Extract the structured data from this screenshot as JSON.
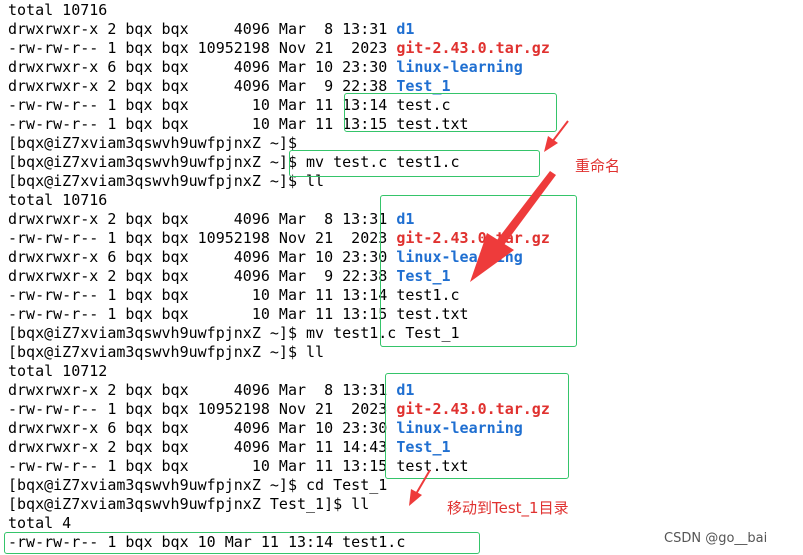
{
  "terminal": {
    "lines": [
      {
        "parts": [
          {
            "t": "total 10716"
          }
        ]
      },
      {
        "parts": [
          {
            "t": "drwxrwxr-x 2 bqx bqx     4096 Mar  8 13:31 "
          },
          {
            "t": "d1",
            "c": "blue"
          }
        ]
      },
      {
        "parts": [
          {
            "t": "-rw-rw-r-- 1 bqx bqx 10952198 Nov 21  2023 "
          },
          {
            "t": "git-2.43.0.tar.gz",
            "c": "red"
          }
        ]
      },
      {
        "parts": [
          {
            "t": "drwxrwxr-x 6 bqx bqx     4096 Mar 10 23:30 "
          },
          {
            "t": "linux-learning",
            "c": "blue"
          }
        ]
      },
      {
        "parts": [
          {
            "t": "drwxrwxr-x 2 bqx bqx     4096 Mar  9 22:38 "
          },
          {
            "t": "Test_1",
            "c": "blue"
          }
        ]
      },
      {
        "parts": [
          {
            "t": "-rw-rw-r-- 1 bqx bqx       10 Mar 11 13:14 test.c"
          }
        ]
      },
      {
        "parts": [
          {
            "t": "-rw-rw-r-- 1 bqx bqx       10 Mar 11 13:15 test.txt"
          }
        ]
      },
      {
        "parts": [
          {
            "t": "[bqx@iZ7xviam3qswvh9uwfpjnxZ ~]$"
          }
        ]
      },
      {
        "parts": [
          {
            "t": "[bqx@iZ7xviam3qswvh9uwfpjnxZ ~]$ mv test.c test1.c"
          }
        ]
      },
      {
        "parts": [
          {
            "t": "[bqx@iZ7xviam3qswvh9uwfpjnxZ ~]$ ll"
          }
        ]
      },
      {
        "parts": [
          {
            "t": "total 10716"
          }
        ]
      },
      {
        "parts": [
          {
            "t": "drwxrwxr-x 2 bqx bqx     4096 Mar  8 13:31 "
          },
          {
            "t": "d1",
            "c": "blue"
          }
        ]
      },
      {
        "parts": [
          {
            "t": "-rw-rw-r-- 1 bqx bqx 10952198 Nov 21  2023 "
          },
          {
            "t": "git-2.43.0.tar.gz",
            "c": "red"
          }
        ]
      },
      {
        "parts": [
          {
            "t": "drwxrwxr-x 6 bqx bqx     4096 Mar 10 23:30 "
          },
          {
            "t": "linux-learning",
            "c": "blue"
          }
        ]
      },
      {
        "parts": [
          {
            "t": "drwxrwxr-x 2 bqx bqx     4096 Mar  9 22:38 "
          },
          {
            "t": "Test_1",
            "c": "blue"
          }
        ]
      },
      {
        "parts": [
          {
            "t": "-rw-rw-r-- 1 bqx bqx       10 Mar 11 13:14 test1.c"
          }
        ]
      },
      {
        "parts": [
          {
            "t": "-rw-rw-r-- 1 bqx bqx       10 Mar 11 13:15 test.txt"
          }
        ]
      },
      {
        "parts": [
          {
            "t": "[bqx@iZ7xviam3qswvh9uwfpjnxZ ~]$ mv test1.c Test_1"
          }
        ]
      },
      {
        "parts": [
          {
            "t": "[bqx@iZ7xviam3qswvh9uwfpjnxZ ~]$ ll"
          }
        ]
      },
      {
        "parts": [
          {
            "t": "total 10712"
          }
        ]
      },
      {
        "parts": [
          {
            "t": "drwxrwxr-x 2 bqx bqx     4096 Mar  8 13:31 "
          },
          {
            "t": "d1",
            "c": "blue"
          }
        ]
      },
      {
        "parts": [
          {
            "t": "-rw-rw-r-- 1 bqx bqx 10952198 Nov 21  2023 "
          },
          {
            "t": "git-2.43.0.tar.gz",
            "c": "red"
          }
        ]
      },
      {
        "parts": [
          {
            "t": "drwxrwxr-x 6 bqx bqx     4096 Mar 10 23:30 "
          },
          {
            "t": "linux-learning",
            "c": "blue"
          }
        ]
      },
      {
        "parts": [
          {
            "t": "drwxrwxr-x 2 bqx bqx     4096 Mar 11 14:43 "
          },
          {
            "t": "Test_1",
            "c": "blue"
          }
        ]
      },
      {
        "parts": [
          {
            "t": "-rw-rw-r-- 1 bqx bqx       10 Mar 11 13:15 test.txt"
          }
        ]
      },
      {
        "parts": [
          {
            "t": "[bqx@iZ7xviam3qswvh9uwfpjnxZ ~]$ cd Test_1"
          }
        ]
      },
      {
        "parts": [
          {
            "t": "[bqx@iZ7xviam3qswvh9uwfpjnxZ Test_1]$ ll"
          }
        ]
      },
      {
        "parts": [
          {
            "t": "total 4"
          }
        ]
      },
      {
        "parts": [
          {
            "t": "-rw-rw-r-- 1 bqx bqx 10 Mar 11 13:14 test1.c"
          }
        ]
      }
    ]
  },
  "annotations": {
    "rename_note": "重命名",
    "move_note": "移动到Test_1目录"
  },
  "watermark": "CSDN @go__bai",
  "colors": {
    "directory": "#1f6fd1",
    "archive": "#e0312f",
    "highlight_box": "#35c46a",
    "arrow": "#ee3b3b"
  }
}
